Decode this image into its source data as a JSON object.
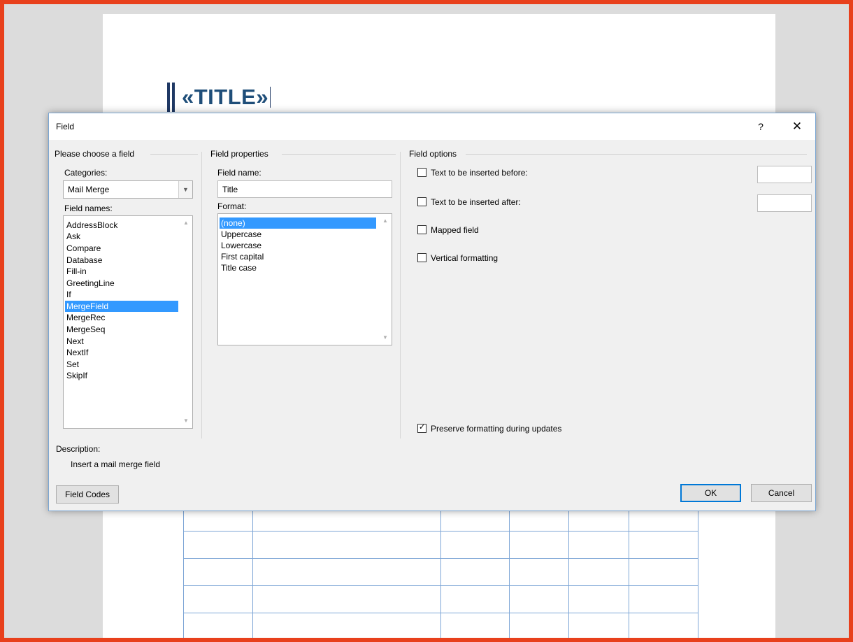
{
  "document": {
    "merge_field_text": "«TITLE»"
  },
  "dialog": {
    "title": "Field",
    "help_label": "?",
    "close_label": "✕",
    "choose_group": {
      "title": "Please choose a field",
      "categories_label": "Categories:",
      "categories_value": "Mail Merge",
      "field_names_label": "Field names:",
      "field_names": [
        "AddressBlock",
        "Ask",
        "Compare",
        "Database",
        "Fill-in",
        "GreetingLine",
        "If",
        "MergeField",
        "MergeRec",
        "MergeSeq",
        "Next",
        "NextIf",
        "Set",
        "SkipIf"
      ],
      "selected_field": "MergeField"
    },
    "properties_group": {
      "title": "Field properties",
      "field_name_label": "Field name:",
      "field_name_value": "Title",
      "format_label": "Format:",
      "formats": [
        "(none)",
        "Uppercase",
        "Lowercase",
        "First capital",
        "Title case"
      ],
      "selected_format": "(none)"
    },
    "options_group": {
      "title": "Field options",
      "text_before_label": "Text to be inserted before:",
      "text_before_checked": false,
      "text_after_label": "Text to be inserted after:",
      "text_after_checked": false,
      "mapped_label": "Mapped field",
      "mapped_checked": false,
      "vertical_label": "Vertical formatting",
      "vertical_checked": false,
      "preserve_label": "Preserve formatting during updates",
      "preserve_checked": true
    },
    "description_label": "Description:",
    "description_text": "Insert a mail merge field",
    "field_codes_button": "Field Codes",
    "ok_button": "OK",
    "cancel_button": "Cancel"
  },
  "colors": {
    "outer_border": "#e8401c",
    "selection": "#3399ff",
    "merge_text": "#1f4e79",
    "ok_border": "#0078d7"
  }
}
